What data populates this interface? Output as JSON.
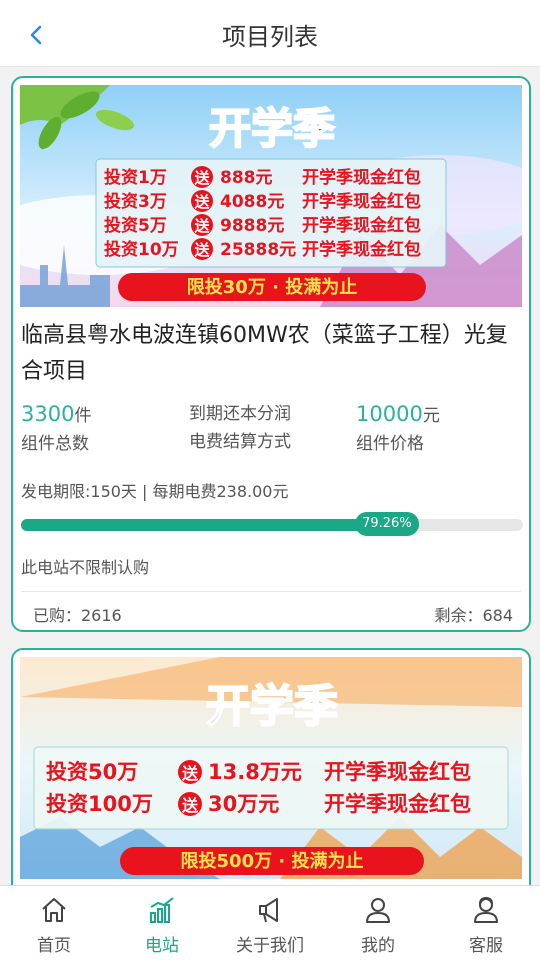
{
  "header": {
    "title": "项目列表"
  },
  "colors": {
    "accent": "#1aa887",
    "card_border": "#2bb29a",
    "banner_red": "#e8131d"
  },
  "projects": [
    {
      "banner": {
        "title": "开学季",
        "rows": [
          {
            "invest": "投资1万",
            "gift": "送",
            "amount": "888元",
            "reward": "开学季现金红包"
          },
          {
            "invest": "投资3万",
            "gift": "送",
            "amount": "4088元",
            "reward": "开学季现金红包"
          },
          {
            "invest": "投资5万",
            "gift": "送",
            "amount": "9888元",
            "reward": "开学季现金红包"
          },
          {
            "invest": "投资10万",
            "gift": "送",
            "amount": "25888元",
            "reward": "开学季现金红包"
          }
        ],
        "limit": "限投30万 · 投满为止"
      },
      "title": "临高县粤水电波连镇60MW农（菜篮子工程）光复合项目",
      "stats": [
        {
          "value": "3300",
          "unit": "件",
          "label": "组件总数"
        },
        {
          "value": "到期还本分润",
          "label": "电费结算方式"
        },
        {
          "value": "10000",
          "unit": "元",
          "label": "组件价格"
        }
      ],
      "period": "发电期限:150天 | 每期电费238.00元",
      "progress": {
        "percent": 79.26,
        "label": "79.26%"
      },
      "note": "此电站不限制认购",
      "bought": "已购：2616",
      "remaining": "剩余：684"
    },
    {
      "banner": {
        "title": "开学季",
        "rows": [
          {
            "invest": "投资50万",
            "gift": "送",
            "amount": "13.8万元",
            "reward": "开学季现金红包"
          },
          {
            "invest": "投资100万",
            "gift": "送",
            "amount": "30万元",
            "reward": "开学季现金红包"
          }
        ],
        "limit": "限投500万 · 投满为止"
      }
    }
  ],
  "tabbar": [
    {
      "label": "首页",
      "icon": "home-icon",
      "active": false
    },
    {
      "label": "电站",
      "icon": "bar-chart-icon",
      "active": true
    },
    {
      "label": "关于我们",
      "icon": "megaphone-icon",
      "active": false
    },
    {
      "label": "我的",
      "icon": "user-icon",
      "active": false
    },
    {
      "label": "客服",
      "icon": "service-icon",
      "active": false
    }
  ]
}
